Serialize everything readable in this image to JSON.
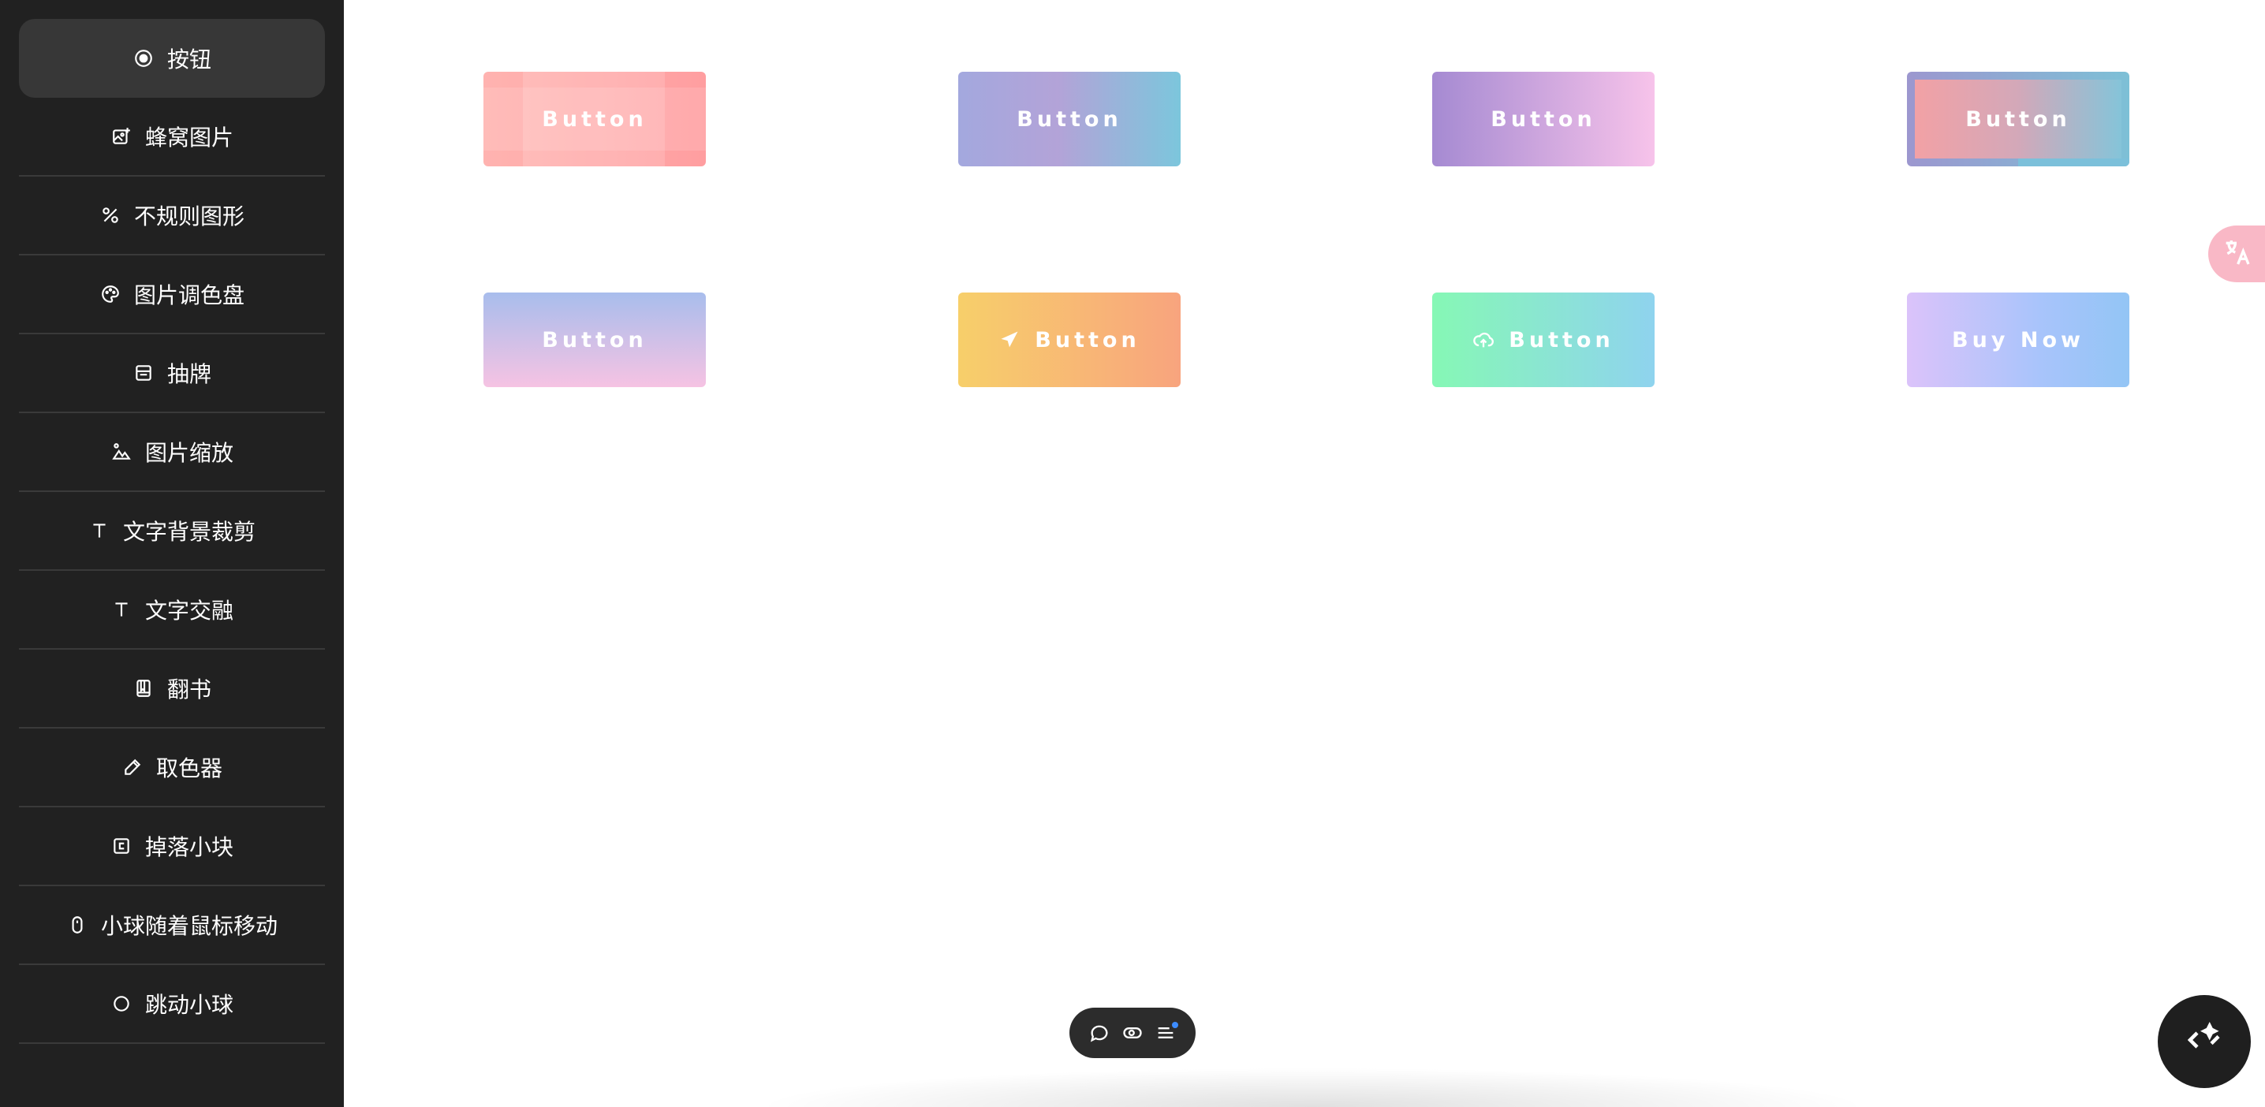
{
  "sidebar": {
    "items": [
      {
        "label": "按钮",
        "icon": "radio-icon",
        "active": true
      },
      {
        "label": "蜂窝图片",
        "icon": "image-plus-icon"
      },
      {
        "label": "不规则图形",
        "icon": "shapes-icon"
      },
      {
        "label": "图片调色盘",
        "icon": "palette-icon"
      },
      {
        "label": "抽牌",
        "icon": "card-icon"
      },
      {
        "label": "图片缩放",
        "icon": "mountain-zoom-icon"
      },
      {
        "label": "文字背景裁剪",
        "icon": "text-icon"
      },
      {
        "label": "文字交融",
        "icon": "text-icon"
      },
      {
        "label": "翻书",
        "icon": "book-icon"
      },
      {
        "label": "取色器",
        "icon": "pipette-icon"
      },
      {
        "label": "掉落小块",
        "icon": "drop-block-icon"
      },
      {
        "label": "小球随着鼠标移动",
        "icon": "mouse-icon"
      },
      {
        "label": "跳动小球",
        "icon": "circle-icon"
      }
    ]
  },
  "buttons": {
    "b1": "Button",
    "b2": "Button",
    "b3": "Button",
    "b4": "Button",
    "b5": "Button",
    "b6": "Button",
    "b7": "Button",
    "b8": "Buy Now"
  },
  "colors": {
    "sidebar_bg": "#212121",
    "active_item_bg": "#373737",
    "translate_tab": "#f9b8c6",
    "toolbar_bg": "#2c2c2c",
    "notify_dot": "#3d8cff"
  },
  "icons": {
    "translate": "translate-icon",
    "toolbar": [
      "chat-icon",
      "toggle-icon",
      "menu-icon"
    ],
    "fab": "code-sparkle-icon"
  }
}
